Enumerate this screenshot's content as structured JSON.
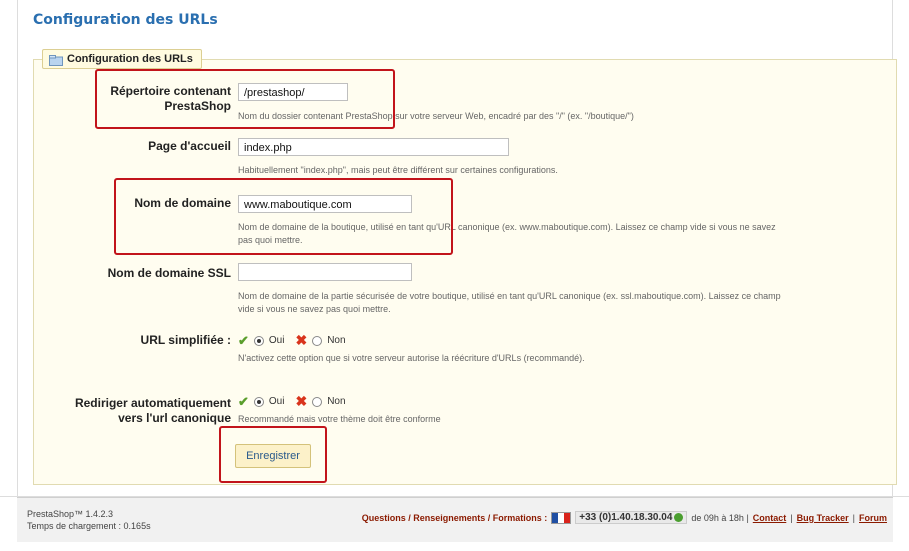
{
  "page": {
    "title": "Configuration des URLs"
  },
  "fieldset": {
    "legend": "Configuration des URLs"
  },
  "fields": {
    "base_dir": {
      "label_line1": "Répertoire contenant",
      "label_line2": "PrestaShop",
      "value": "/prestashop/",
      "hint": "Nom du dossier contenant PrestaShop sur votre serveur Web, encadré par des \"/\" (ex. \"/boutique/\")"
    },
    "home_page": {
      "label": "Page d'accueil",
      "value": "index.php",
      "hint": "Habituellement \"index.php\", mais peut être différent sur certaines configurations."
    },
    "domain": {
      "label": "Nom de domaine",
      "value": "www.maboutique.com",
      "hint_line1": "Nom de domaine de la boutique, utilisé en tant qu'URL canonique (ex. www.maboutique.com). Laissez ce champ vide si vous ne savez",
      "hint_line2": "pas quoi mettre."
    },
    "domain_ssl": {
      "label": "Nom de domaine SSL",
      "value": "",
      "hint_line1": "Nom de domaine de la partie sécurisée de votre boutique, utilisé en tant qu'URL canonique (ex. ssl.maboutique.com). Laissez ce champ",
      "hint_line2": "vide si vous ne savez pas quoi mettre."
    },
    "friendly_url": {
      "label": "URL simplifiée :",
      "yes": "Oui",
      "no": "Non",
      "selected": "Oui",
      "hint": "N'activez cette option que si votre serveur autorise la réécriture d'URLs (recommandé)."
    },
    "canonical_redirect": {
      "label_line1": "Rediriger automatiquement",
      "label_line2": "vers l'url canonique",
      "yes": "Oui",
      "no": "Non",
      "selected": "Oui",
      "hint": "Recommandé mais votre thème doit être conforme"
    }
  },
  "actions": {
    "save": "Enregistrer"
  },
  "footer": {
    "version": "PrestaShop™ 1.4.2.3",
    "load_time": "Temps de chargement : 0.165s",
    "questions": "Questions / Renseignements / Formations :",
    "phone": "+33 (0)1.40.18.30.04",
    "hours": "de 09h à 18h |",
    "contact": "Contact",
    "sep1": "|",
    "bug_tracker": "Bug Tracker",
    "sep2": "|",
    "forum": "Forum"
  },
  "colors": {
    "accent": "#2a6fb0",
    "highlight": "#c2141b",
    "fieldset_bg": "#fffdf0"
  },
  "icons": {
    "legend": "folder-icon",
    "yes": "checkmark-icon",
    "no": "cross-icon",
    "phone_status": "online-dot-icon"
  }
}
